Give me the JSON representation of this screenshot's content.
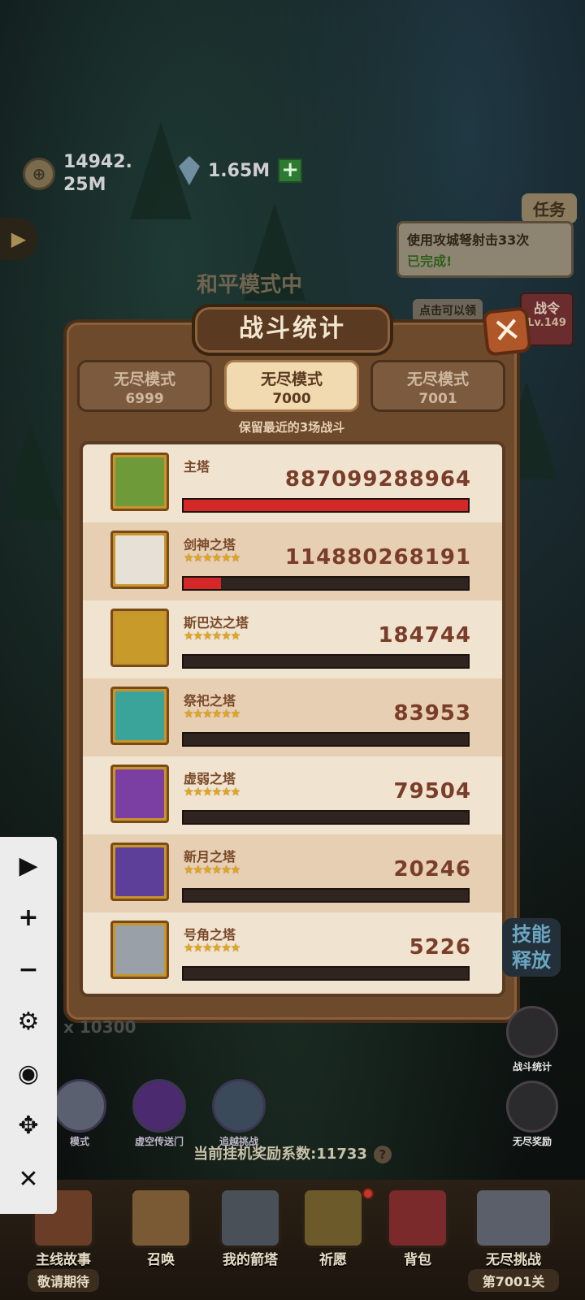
{
  "top_bar": {
    "gold_amount": "14942.\n25M",
    "gem_amount": "1.65M",
    "gold_icon": "coin-icon",
    "gem_icon": "diamond-icon"
  },
  "quest": {
    "tab_label": "任务",
    "description": "使用攻城弩射击33次",
    "status": "已完成!",
    "tap_hint": "点击可以领"
  },
  "battle_order": {
    "label": "战令",
    "level": "Lv.149"
  },
  "background_text": "和平模式中",
  "dialog": {
    "title": "战斗统计",
    "close_label": "✕",
    "note": "保留最近的3场战斗",
    "tabs": [
      {
        "mode": "无尽模式",
        "level": "6999",
        "active": false
      },
      {
        "mode": "无尽模式",
        "level": "7000",
        "active": true
      },
      {
        "mode": "无尽模式",
        "level": "7001",
        "active": false
      }
    ],
    "rows": [
      {
        "name": "主塔",
        "damage": "887099288964",
        "stars": "",
        "fill": 1.0,
        "portrait_color": "#6f9a3a"
      },
      {
        "name": "剑神之塔",
        "damage": "114880268191",
        "stars": "★★★★★★",
        "fill": 0.13,
        "portrait_color": "#e6e0d6"
      },
      {
        "name": "斯巴达之塔",
        "damage": "184744",
        "stars": "★★★★★★",
        "fill": 0.0,
        "portrait_color": "#c79a2a"
      },
      {
        "name": "祭祀之塔",
        "damage": "83953",
        "stars": "★★★★★★",
        "fill": 0.0,
        "portrait_color": "#3aa39a"
      },
      {
        "name": "虚弱之塔",
        "damage": "79504",
        "stars": "★★★★★★",
        "fill": 0.0,
        "portrait_color": "#7b3fa3"
      },
      {
        "name": "新月之塔",
        "damage": "20246",
        "stars": "★★★★★★",
        "fill": 0.0,
        "portrait_color": "#5d3f9a"
      },
      {
        "name": "号角之塔",
        "damage": "5226",
        "stars": "★★★★★★",
        "fill": 0.0,
        "portrait_color": "#9aa0a8"
      }
    ]
  },
  "toolbar": {
    "play": "▶",
    "zoom_in": "+",
    "zoom_out": "−",
    "settings": "⚙",
    "view": "◉",
    "move": "✥",
    "close": "✕"
  },
  "right_side": {
    "skill_text": "技能\n释放",
    "battle_stats_label": "战斗统计",
    "endless_reward_label": "无尽奖励"
  },
  "mid_icons": [
    {
      "label": "模式",
      "color": "#5a6070"
    },
    {
      "label": "虚空传送门",
      "color": "#4b2a6f"
    },
    {
      "label": "追越挑战",
      "color": "#3b4a5a"
    }
  ],
  "reward_coefficient": {
    "label": "当前挂机奖励系数:",
    "value": "11733",
    "help": "?"
  },
  "faded_multiplier": "x 10300",
  "bottom_nav": [
    {
      "label": "主线故事",
      "sub": "敬请期待"
    },
    {
      "label": "召唤",
      "sub": ""
    },
    {
      "label": "我的箭塔",
      "sub": ""
    },
    {
      "label": "祈愿",
      "sub": ""
    },
    {
      "label": "背包",
      "sub": ""
    },
    {
      "label": "无尽挑战",
      "sub": "第7001关"
    }
  ]
}
